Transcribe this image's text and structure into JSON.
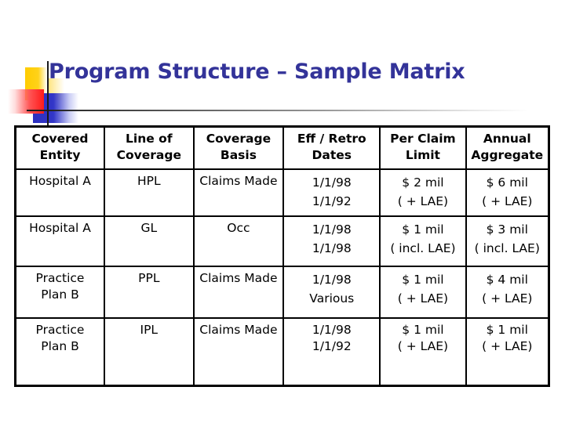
{
  "slide": {
    "title": "Program Structure – Sample Matrix"
  },
  "table": {
    "headers": [
      [
        "Covered",
        "Entity"
      ],
      [
        "Line of",
        "Coverage"
      ],
      [
        "Coverage",
        "Basis"
      ],
      [
        "Eff / Retro",
        "Dates"
      ],
      [
        "Per Claim",
        "Limit"
      ],
      [
        "Annual",
        "Aggregate"
      ]
    ],
    "rows": [
      {
        "covered_entity": [
          "Hospital A"
        ],
        "line_of_coverage": "HPL",
        "coverage_basis": "Claims Made",
        "dates": [
          "1/1/98",
          "1/1/92"
        ],
        "per_claim_limit": [
          "$ 2 mil",
          "( + LAE)"
        ],
        "annual_aggregate": [
          "$ 6 mil",
          "( + LAE)"
        ]
      },
      {
        "covered_entity": [
          "Hospital A"
        ],
        "line_of_coverage": "GL",
        "coverage_basis": "Occ",
        "dates": [
          "1/1/98",
          "1/1/98"
        ],
        "per_claim_limit": [
          "$ 1 mil",
          "( incl. LAE)"
        ],
        "annual_aggregate": [
          "$ 3 mil",
          "( incl. LAE)"
        ]
      },
      {
        "covered_entity": [
          "Practice",
          "Plan B"
        ],
        "line_of_coverage": "PPL",
        "coverage_basis": "Claims Made",
        "dates": [
          "1/1/98",
          "Various"
        ],
        "per_claim_limit": [
          "$ 1 mil",
          "( + LAE)"
        ],
        "annual_aggregate": [
          "$ 4 mil",
          "( + LAE)"
        ]
      },
      {
        "covered_entity": [
          "Practice",
          "Plan B"
        ],
        "line_of_coverage": "IPL",
        "coverage_basis": "Claims Made",
        "dates": [
          "1/1/98",
          "1/1/92"
        ],
        "per_claim_limit": [
          "$ 1 mil",
          "( + LAE)"
        ],
        "annual_aggregate": [
          "$ 1 mil",
          "( + LAE)"
        ]
      }
    ]
  },
  "colors": {
    "title": "#333399",
    "accent_yellow": "#ffcc00",
    "accent_red": "#ff1a1a",
    "accent_blue": "#2b2fbf"
  }
}
